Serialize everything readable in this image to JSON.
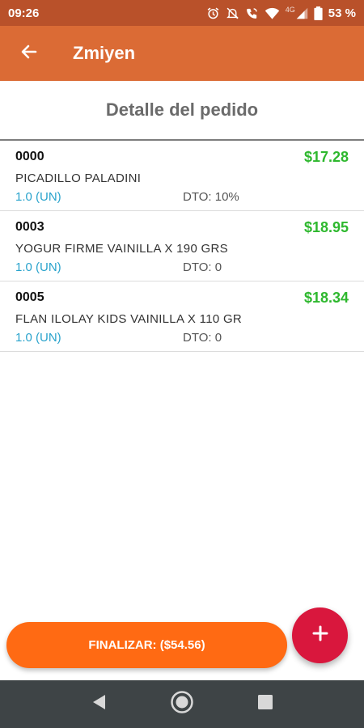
{
  "status_bar": {
    "time": "09:26",
    "network": "4G",
    "battery": "53 %"
  },
  "app_bar": {
    "title": "Zmiyen",
    "back_icon": "arrow-left-icon"
  },
  "page": {
    "title": "Detalle del pedido"
  },
  "items": [
    {
      "code": "0000",
      "name": "PICADILLO PALADINI",
      "quantity": "1.0 (UN)",
      "discount": "DTO: 10%",
      "price": "$17.28"
    },
    {
      "code": "0003",
      "name": "YOGUR FIRME VAINILLA X 190 GRS",
      "quantity": "1.0 (UN)",
      "discount": "DTO: 0",
      "price": "$18.95"
    },
    {
      "code": "0005",
      "name": "FLAN ILOLAY KIDS VAINILLA X 110 GR",
      "quantity": "1.0 (UN)",
      "discount": "DTO: 0",
      "price": "$18.34"
    }
  ],
  "footer": {
    "finalize_label": "FINALIZAR: ($54.56)",
    "add_icon": "plus-icon"
  },
  "colors": {
    "status_bar": "#b9512a",
    "app_bar": "#db6b35",
    "price": "#2eb82e",
    "quantity": "#29a3cc",
    "finalize_button": "#ff6a13",
    "fab": "#d9173d",
    "nav_bar": "#3e4446"
  }
}
